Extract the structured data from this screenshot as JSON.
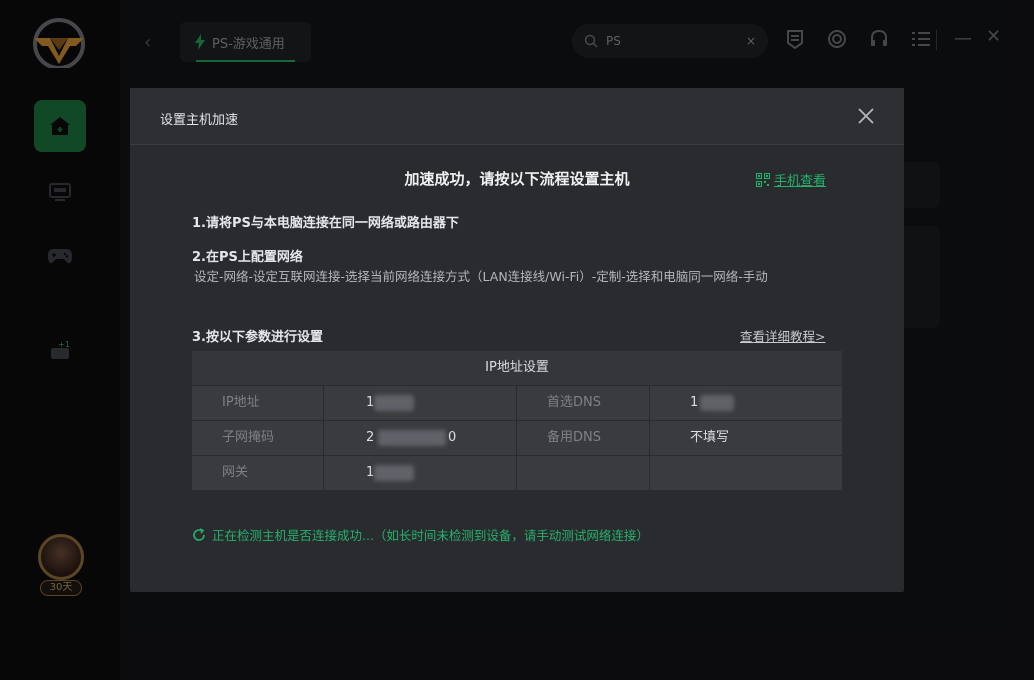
{
  "app": {
    "avatar_badge": "30天"
  },
  "topbar": {
    "game_tab_label": "PS-游戏通用",
    "search_value": "PS",
    "search_clear": "×"
  },
  "dialog": {
    "title": "设置主机加速",
    "headline": "加速成功，请按以下流程设置主机",
    "phone_link": "手机查看",
    "step1": "1.请将PS与本电脑连接在同一网络或路由器下",
    "step2": "2.在PS上配置网络",
    "step2_desc": "设定-网络-设定互联网连接-选择当前网络连接方式（LAN连接线/Wi-Fi）-定制-选择和电脑同一网络-手动",
    "step3": "3.按以下参数进行设置",
    "tutorial_link": "查看详细教程>",
    "table": {
      "header": "IP地址设置",
      "rows": [
        {
          "label1": "IP地址",
          "value1": "1",
          "label2": "首选DNS",
          "value2": "1"
        },
        {
          "label1": "子网掩码",
          "value1": "2",
          "value1_suffix": "0",
          "label2": "备用DNS",
          "value2": "不填写"
        },
        {
          "label1": "网关",
          "value1": "1",
          "label2": "",
          "value2": ""
        }
      ]
    },
    "status": "正在检测主机是否连接成功...（如长时间未检测到设备，请手动测试网络连接）"
  },
  "colors": {
    "accent": "#23b26a",
    "nav_active": "#1b6f3a",
    "dialog_bg": "#2a2b2f"
  }
}
